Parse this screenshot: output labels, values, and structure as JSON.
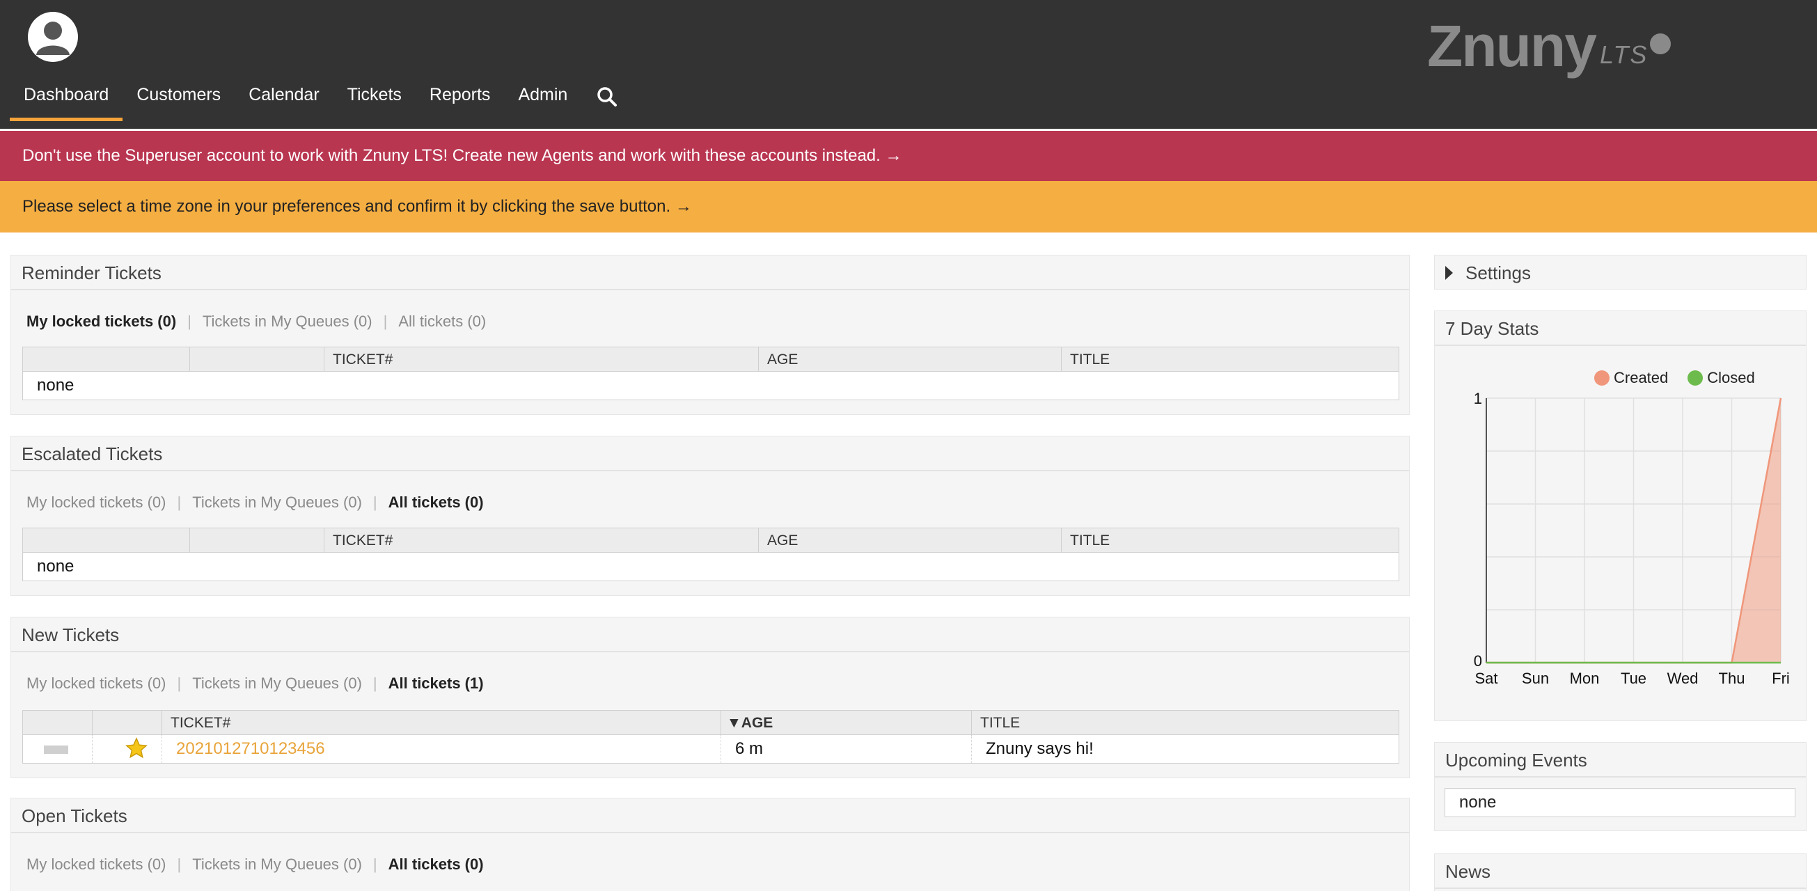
{
  "header": {
    "logo": {
      "name": "Znuny",
      "suffix": "LTS"
    },
    "nav": [
      {
        "label": "Dashboard",
        "active": true
      },
      {
        "label": "Customers",
        "active": false
      },
      {
        "label": "Calendar",
        "active": false
      },
      {
        "label": "Tickets",
        "active": false
      },
      {
        "label": "Reports",
        "active": false
      },
      {
        "label": "Admin",
        "active": false
      }
    ],
    "search_icon": "search-icon",
    "accent_color": "#f5a33b"
  },
  "notices": {
    "superuser": "Don't use the Superuser account to work with Znuny LTS! Create new Agents and work with these accounts instead. →",
    "timezone": "Please select a time zone in your preferences and confirm it by clicking the save button. →",
    "red_color": "#b93651",
    "orange_color": "#f5ae42"
  },
  "widgets": {
    "reminder": {
      "title": "Reminder Tickets",
      "filters": [
        {
          "label": "My locked tickets (0)",
          "active": true
        },
        {
          "label": "Tickets in My Queues (0)",
          "active": false
        },
        {
          "label": "All tickets (0)",
          "active": false
        }
      ],
      "columns": [
        "TICKET#",
        "AGE",
        "TITLE"
      ],
      "empty": "none"
    },
    "escalated": {
      "title": "Escalated Tickets",
      "filters": [
        {
          "label": "My locked tickets (0)",
          "active": false
        },
        {
          "label": "Tickets in My Queues (0)",
          "active": false
        },
        {
          "label": "All tickets (0)",
          "active": true
        }
      ],
      "columns": [
        "TICKET#",
        "AGE",
        "TITLE"
      ],
      "empty": "none"
    },
    "new": {
      "title": "New Tickets",
      "filters": [
        {
          "label": "My locked tickets (0)",
          "active": false
        },
        {
          "label": "Tickets in My Queues (0)",
          "active": false
        },
        {
          "label": "All tickets (1)",
          "active": true
        }
      ],
      "columns": [
        "TICKET#",
        "▼AGE",
        "TITLE"
      ],
      "rows": [
        {
          "ticket": "2021012710123456",
          "age": "6 m",
          "title": "Znuny says hi!"
        }
      ]
    },
    "open": {
      "title": "Open Tickets",
      "filters": [
        {
          "label": "My locked tickets (0)",
          "active": false
        },
        {
          "label": "Tickets in My Queues (0)",
          "active": false
        },
        {
          "label": "All tickets (0)",
          "active": true
        }
      ]
    }
  },
  "sidebar": {
    "settings": "Settings",
    "stats": {
      "title": "7 Day Stats"
    },
    "upcoming": {
      "title": "Upcoming Events",
      "empty": "none"
    },
    "news": {
      "title": "News"
    }
  },
  "chart_data": {
    "type": "area",
    "title": "",
    "xlabel": "",
    "ylabel": "",
    "x": [
      "Sat",
      "Sun",
      "Mon",
      "Tue",
      "Wed",
      "Thu",
      "Fri"
    ],
    "ylim": [
      0,
      1
    ],
    "yticks": [
      "0",
      "1"
    ],
    "grid": true,
    "legend_position": "top-right",
    "series": [
      {
        "name": "Created",
        "color": "#f0967a",
        "values": [
          0,
          0,
          0,
          0,
          0,
          0,
          1
        ]
      },
      {
        "name": "Closed",
        "color": "#6dbb4c",
        "values": [
          0,
          0,
          0,
          0,
          0,
          0,
          0
        ]
      }
    ]
  }
}
